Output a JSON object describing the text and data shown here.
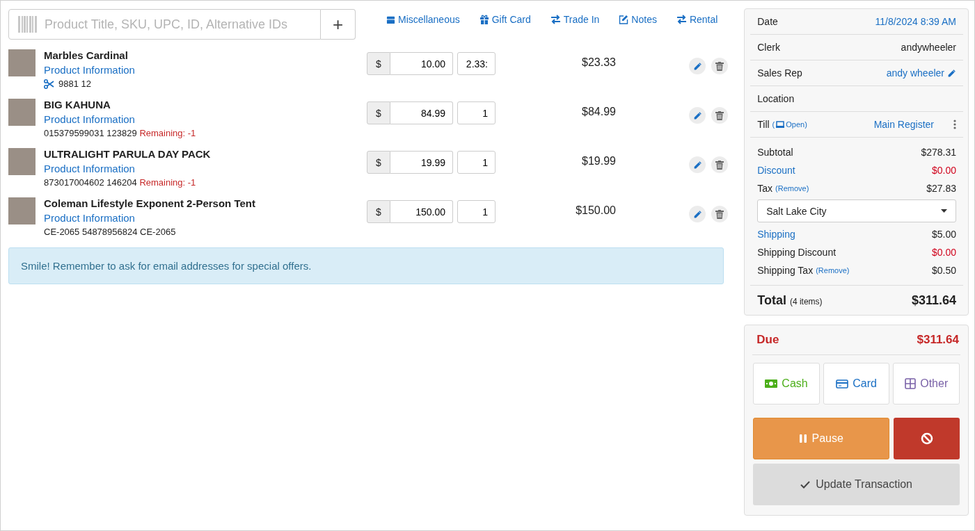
{
  "search": {
    "placeholder": "Product Title, SKU, UPC, ID, Alternative IDs",
    "add_button": "+"
  },
  "quick_actions": [
    {
      "label": "Miscellaneous",
      "kind": "box"
    },
    {
      "label": "Gift Card",
      "kind": "gift"
    },
    {
      "label": "Trade In",
      "kind": "swap"
    },
    {
      "label": "Notes",
      "kind": "notes"
    },
    {
      "label": "Rental",
      "kind": "swap"
    }
  ],
  "items": [
    {
      "title": "Marbles Cardinal",
      "link": "Product Information",
      "cut": true,
      "codes": "9881 12",
      "price_symbol": "$",
      "price": "10.00",
      "quantity": "2.33:",
      "total": "$23.33"
    },
    {
      "title": "BIG KAHUNA",
      "link": "Product Information",
      "cut": false,
      "codes": "015379599031  123829",
      "remaining": "Remaining: -1",
      "price_symbol": "$",
      "price": "84.99",
      "quantity": "1",
      "total": "$84.99"
    },
    {
      "title": "ULTRALIGHT PARULA DAY PACK",
      "link": "Product Information",
      "cut": false,
      "codes": "873017004602  146204",
      "remaining": "Remaining: -1",
      "price_symbol": "$",
      "price": "19.99",
      "quantity": "1",
      "total": "$19.99"
    },
    {
      "title": "Coleman Lifestyle Exponent 2-Person Tent",
      "link": "Product Information",
      "cut": false,
      "codes": "CE-2065 54878956824  CE-2065",
      "price_symbol": "$",
      "price": "150.00",
      "quantity": "1",
      "total": "$150.00"
    }
  ],
  "alert": "Smile! Remember to ask for email addresses for special offers.",
  "summary": {
    "info": [
      {
        "label": "Date",
        "value": "11/8/2024 8:39 AM",
        "kind": "link"
      },
      {
        "label": "Clerk",
        "value": "andywheeler",
        "kind": "plain"
      },
      {
        "label": "Sales Rep",
        "value": "andy wheeler",
        "kind": "editable"
      },
      {
        "label": "Location",
        "kind": "plain"
      },
      {
        "label": "Till",
        "note": {
          "open": "(",
          "text": "Open)"
        },
        "value": "Main Register",
        "kind": "till"
      }
    ],
    "lines": [
      {
        "label": "Subtotal",
        "label_link": false,
        "value": "$278.31",
        "value_red": false
      },
      {
        "label": "Discount",
        "label_link": true,
        "value": "$0.00",
        "value_red": true
      },
      {
        "label": "Tax",
        "label_link": false,
        "remove": "(Remove)",
        "value": "$27.83",
        "value_red": false
      }
    ],
    "tax_region": "Salt Lake City",
    "lines_after": [
      {
        "label": "Shipping",
        "label_link": true,
        "value": "$5.00",
        "value_red": false
      },
      {
        "label": "Shipping Discount",
        "label_link": false,
        "value": "$0.00",
        "value_red": true
      },
      {
        "label": "Shipping Tax",
        "label_link": false,
        "remove": "(Remove)",
        "value": "$0.50",
        "value_red": false
      }
    ],
    "total": {
      "label": "Total",
      "note": "(4 items)",
      "value": "$311.64"
    }
  },
  "payment": {
    "due_label": "Due",
    "due_value": "$311.64",
    "methods": [
      {
        "label": "Cash",
        "kind": "cash"
      },
      {
        "label": "Card",
        "kind": "card"
      },
      {
        "label": "Other",
        "kind": "other"
      }
    ],
    "pause": "Pause",
    "update": "Update Transaction"
  }
}
